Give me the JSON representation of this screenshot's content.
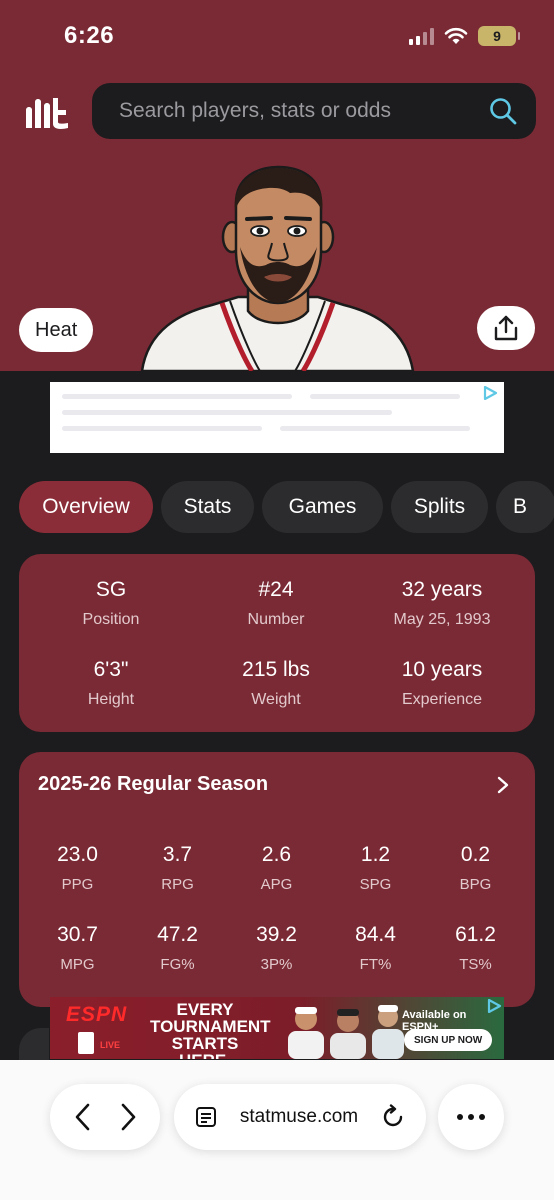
{
  "status_bar": {
    "time": "6:26",
    "battery": "9"
  },
  "search": {
    "placeholder": "Search players, stats or odds"
  },
  "player": {
    "team": "Heat"
  },
  "tabs": [
    "Overview",
    "Stats",
    "Games",
    "Splits",
    "B"
  ],
  "bio": [
    {
      "value": "SG",
      "label": "Position"
    },
    {
      "value": "#24",
      "label": "Number"
    },
    {
      "value": "32 years",
      "label": "May 25, 1993"
    },
    {
      "value": "6'3\"",
      "label": "Height"
    },
    {
      "value": "215 lbs",
      "label": "Weight"
    },
    {
      "value": "10 years",
      "label": "Experience"
    }
  ],
  "season": {
    "title": "2025-26 Regular Season",
    "stats": [
      {
        "value": "23.0",
        "label": "PPG"
      },
      {
        "value": "3.7",
        "label": "RPG"
      },
      {
        "value": "2.6",
        "label": "APG"
      },
      {
        "value": "1.2",
        "label": "SPG"
      },
      {
        "value": "0.2",
        "label": "BPG"
      },
      {
        "value": "30.7",
        "label": "MPG"
      },
      {
        "value": "47.2",
        "label": "FG%"
      },
      {
        "value": "39.2",
        "label": "3P%"
      },
      {
        "value": "84.4",
        "label": "FT%"
      },
      {
        "value": "61.2",
        "label": "TS%"
      }
    ]
  },
  "ad": {
    "brand": "ESPN",
    "live": "LIVE",
    "headline": "EVERY TOURNAMENT STARTS HERE.",
    "available": "Available on ESPN+",
    "cta": "SIGN UP NOW"
  },
  "browser": {
    "url": "statmuse.com"
  },
  "colors": {
    "maroon": "#7a2a35",
    "tab_active": "#8a2d38",
    "dark_bg": "#1c1c1e",
    "accent_cyan": "#5ec8e5"
  }
}
